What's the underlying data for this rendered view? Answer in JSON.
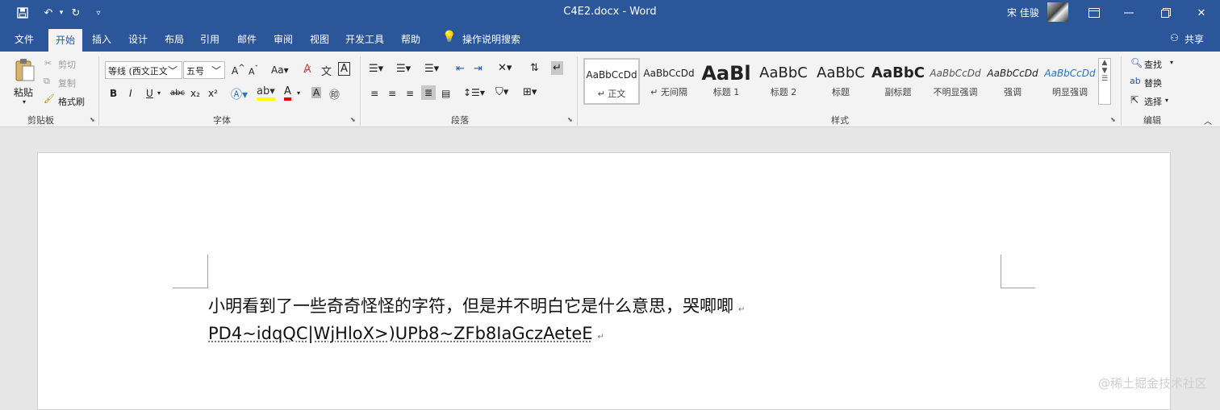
{
  "titlebar": {
    "doc_title": "C4E2.docx - Word",
    "user_name": "宋 佳骏",
    "icons": [
      "save-icon",
      "undo-icon",
      "redo-icon",
      "customize-icon",
      "ribbon-display-icon",
      "restore-icon",
      "close-icon"
    ]
  },
  "menu": {
    "tabs": [
      "文件",
      "开始",
      "插入",
      "设计",
      "布局",
      "引用",
      "邮件",
      "审阅",
      "视图",
      "开发工具",
      "帮助"
    ],
    "tellme": "操作说明搜索",
    "share": "共享"
  },
  "ribbon": {
    "clipboard": {
      "paste": "粘贴",
      "cut": "剪切",
      "copy": "复制",
      "format_painter": "格式刷",
      "label": "剪贴板"
    },
    "font": {
      "family": "等线 (西文正文)",
      "size": "五号",
      "label": "字体"
    },
    "paragraph": {
      "label": "段落"
    },
    "styles": {
      "label": "样式",
      "items": [
        {
          "sample": "AaBbCcDd",
          "name": "正文"
        },
        {
          "sample": "AaBbCcDd",
          "name": "无间隔"
        },
        {
          "sample": "AaBl",
          "name": "标题 1"
        },
        {
          "sample": "AaBbC",
          "name": "标题 2"
        },
        {
          "sample": "AaBbC",
          "name": "标题"
        },
        {
          "sample": "AaBbC",
          "name": "副标题"
        },
        {
          "sample": "AaBbCcDd",
          "name": "不明显强调"
        },
        {
          "sample": "AaBbCcDd",
          "name": "强调"
        },
        {
          "sample": "AaBbCcDd",
          "name": "明显强调"
        }
      ]
    },
    "editing": {
      "find": "查找",
      "replace": "替换",
      "select": "选择",
      "label": "编辑"
    }
  },
  "document": {
    "line1": "小明看到了一些奇奇怪怪的字符，但是并不明白它是什么意思，哭唧唧",
    "line2": "PD4~idqQC|WjHloX>)UPb8~ZFb8IaGczAeteE",
    "para_mark": "↵"
  },
  "watermark": "@稀土掘金技术社区",
  "colors": {
    "accent": "#2b579a",
    "ribbon_bg": "#f3f3f3",
    "canvas": "#e6e6e6"
  }
}
